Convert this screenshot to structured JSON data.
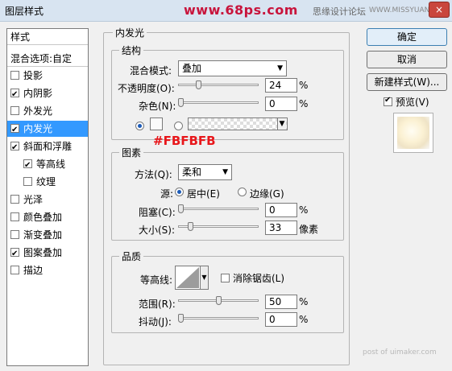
{
  "window": {
    "title": "图层样式",
    "site": "www.68ps.com",
    "watermark_cn": "思缘设计论坛",
    "watermark_en": "WWW.MISSYUAN.COM",
    "close": "×"
  },
  "left": {
    "header": "样式",
    "blend": "混合选项:自定",
    "items": [
      {
        "label": "投影",
        "checked": false
      },
      {
        "label": "内阴影",
        "checked": true
      },
      {
        "label": "外发光",
        "checked": false
      },
      {
        "label": "内发光",
        "checked": true
      },
      {
        "label": "斜面和浮雕",
        "checked": true
      },
      {
        "label": "等高线",
        "checked": true
      },
      {
        "label": "纹理",
        "checked": false
      },
      {
        "label": "光泽",
        "checked": false
      },
      {
        "label": "颜色叠加",
        "checked": false
      },
      {
        "label": "渐变叠加",
        "checked": false
      },
      {
        "label": "图案叠加",
        "checked": true
      },
      {
        "label": "描边",
        "checked": false
      }
    ]
  },
  "main": {
    "title": "内发光",
    "structure": {
      "title": "结构",
      "blend_label": "混合模式:",
      "blend_value": "叠加",
      "opacity_label": "不透明度(O):",
      "opacity_value": "24",
      "opacity_fraction": 0.24,
      "pct": "%",
      "noise_label": "杂色(N):",
      "noise_value": "0",
      "noise_fraction": 0.0
    },
    "color_tag": "#FBFBFB",
    "elements": {
      "title": "图素",
      "method_label": "方法(Q):",
      "method_value": "柔和",
      "source_label": "源:",
      "source_center": "居中(E)",
      "source_edge": "边缘(G)",
      "choke_label": "阻塞(C):",
      "choke_value": "0",
      "choke_fraction": 0.0,
      "pct": "%",
      "size_label": "大小(S):",
      "size_value": "33",
      "size_fraction": 0.13,
      "size_unit": "像素"
    },
    "quality": {
      "title": "品质",
      "contour_label": "等高线:",
      "antialias_label": "消除锯齿(L)",
      "range_label": "范围(R):",
      "range_value": "50",
      "range_fraction": 0.5,
      "pct": "%",
      "jitter_label": "抖动(J):",
      "jitter_value": "0",
      "jitter_fraction": 0.0
    }
  },
  "buttons": {
    "ok": "确定",
    "cancel": "取消",
    "new_style": "新建样式(W)...",
    "preview": "预览(V)"
  },
  "footer": {
    "watermark": "post of uimaker.com"
  },
  "colors": {
    "glow": "#FBFBFB",
    "selection": "#3399ff",
    "accent_red": "#e8171b"
  }
}
